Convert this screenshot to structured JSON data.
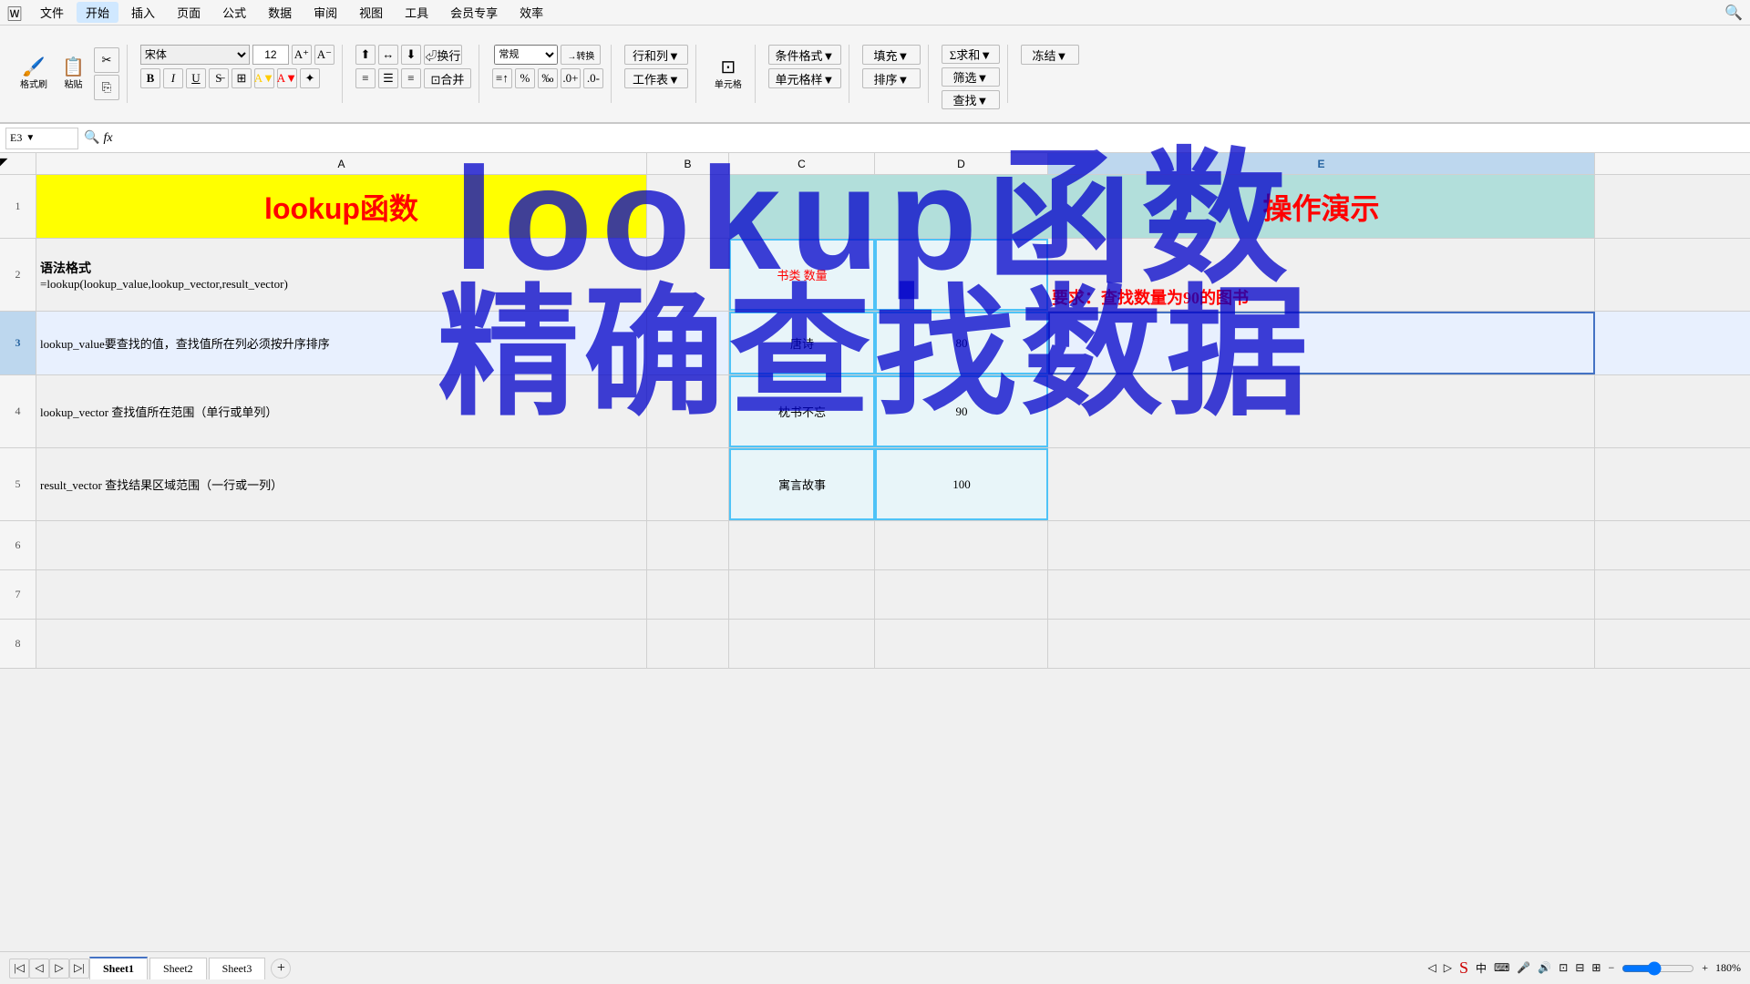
{
  "menu": {
    "items": [
      "文件",
      "开始",
      "插入",
      "页面",
      "公式",
      "数据",
      "审阅",
      "视图",
      "工具",
      "会员专享",
      "效率"
    ]
  },
  "ribbon": {
    "active_tab": "开始",
    "font_name": "宋体",
    "font_size": "12",
    "groups": {
      "clipboard": [
        "格式刷",
        "粘贴"
      ],
      "font_btns": [
        "B",
        "I",
        "U"
      ]
    }
  },
  "formula_bar": {
    "cell_ref": "E3",
    "formula": ""
  },
  "columns": {
    "headers": [
      "A",
      "B",
      "C",
      "D",
      "E"
    ]
  },
  "rows": {
    "numbers": [
      1,
      2,
      3,
      4,
      5,
      6,
      7,
      8
    ]
  },
  "cells": {
    "a1": "lookup函数",
    "a2_line1": "语法格式",
    "a2_line2": "=lookup(lookup_value,lookup_vector,result_vector)",
    "a3": "lookup_value要查找的值，查找值所在列必须按升序排序",
    "a4": "lookup_vector 查找值所在范围（单行或单列）",
    "a5": "result_vector 查找结果区域范围（一行或一列）",
    "e1": "操作演示",
    "e2_req": "要求：查找数量为90的图书",
    "e2_header_left": "书类",
    "e2_header_right": "数量",
    "e3_book": "唐诗",
    "e3_qty": "80",
    "e4_book": "枕书不忘",
    "e4_qty": "90",
    "e5_book": "寓言故事",
    "e5_qty": "100"
  },
  "overlay": {
    "line1": "lookup函数",
    "line2": "精确查找数据"
  },
  "sheets": {
    "tabs": [
      "Sheet1",
      "Sheet2",
      "Sheet3"
    ]
  },
  "status": {
    "zoom": "180%"
  }
}
